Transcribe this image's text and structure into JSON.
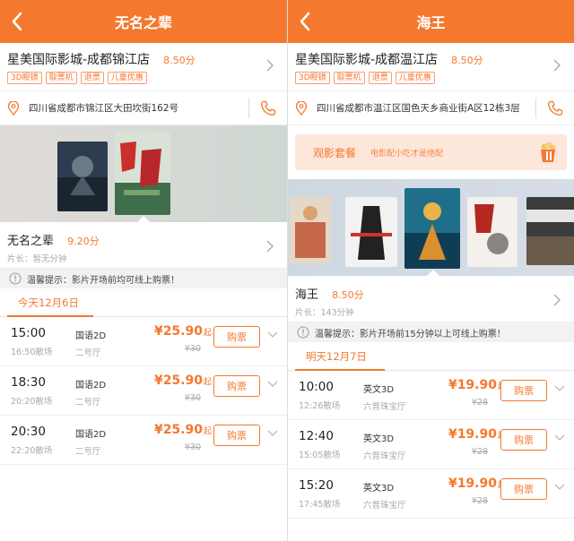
{
  "colors": {
    "accent": "#f4782e",
    "tip_bg": "#f2f2f2",
    "package_bg": "#fde6da"
  },
  "left": {
    "title": "无名之辈",
    "cinema": {
      "name": "星美国际影城-成都锦江店",
      "score": "8.50分",
      "tags": [
        "3D眼镜",
        "取票机",
        "退票",
        "儿童优惠"
      ]
    },
    "address": "四川省成都市锦江区大田坎街162号",
    "movie": {
      "name": "无名之辈",
      "score": "9.20分",
      "duration": "片长：暂无分钟"
    },
    "tip": "温馨提示：影片开场前均可线上购票！",
    "date": "今天12月6日",
    "showtimes": [
      {
        "time": "15:00",
        "end": "16:50散场",
        "lang": "国语2D",
        "hall": "二号厅",
        "price": "¥25.90",
        "qi": "起",
        "orig": "¥30",
        "buy": "购票"
      },
      {
        "time": "18:30",
        "end": "20:20散场",
        "lang": "国语2D",
        "hall": "二号厅",
        "price": "¥25.90",
        "qi": "起",
        "orig": "¥30",
        "buy": "购票"
      },
      {
        "time": "20:30",
        "end": "22:20散场",
        "lang": "国语2D",
        "hall": "二号厅",
        "price": "¥25.90",
        "qi": "起",
        "orig": "¥30",
        "buy": "购票"
      }
    ]
  },
  "right": {
    "title": "海王",
    "cinema": {
      "name": "星美国际影城-成都温江店",
      "score": "8.50分",
      "tags": [
        "3D眼镜",
        "取票机",
        "退票",
        "儿童优惠"
      ]
    },
    "address": "四川省成都市温江区国色天乡商业街A区12栋3层",
    "package": {
      "label": "观影套餐",
      "sub": "电影配小吃才是绝配"
    },
    "movie": {
      "name": "海王",
      "score": "8.50分",
      "duration": "片长：143分钟"
    },
    "tip": "温馨提示：影片开场前15分钟以上可线上购票！",
    "date": "明天12月7日",
    "showtimes": [
      {
        "time": "10:00",
        "end": "12:26散场",
        "lang": "英文3D",
        "hall": "六普珠宝厅",
        "price": "¥19.90",
        "qi": "起",
        "orig": "¥28",
        "buy": "购票"
      },
      {
        "time": "12:40",
        "end": "15:05散场",
        "lang": "英文3D",
        "hall": "六普珠宝厅",
        "price": "¥19.90",
        "qi": "起",
        "orig": "¥28",
        "buy": "购票"
      },
      {
        "time": "15:20",
        "end": "17:45散场",
        "lang": "英文3D",
        "hall": "六普珠宝厅",
        "price": "¥19.90",
        "qi": "起",
        "orig": "¥28",
        "buy": "购票"
      }
    ]
  }
}
